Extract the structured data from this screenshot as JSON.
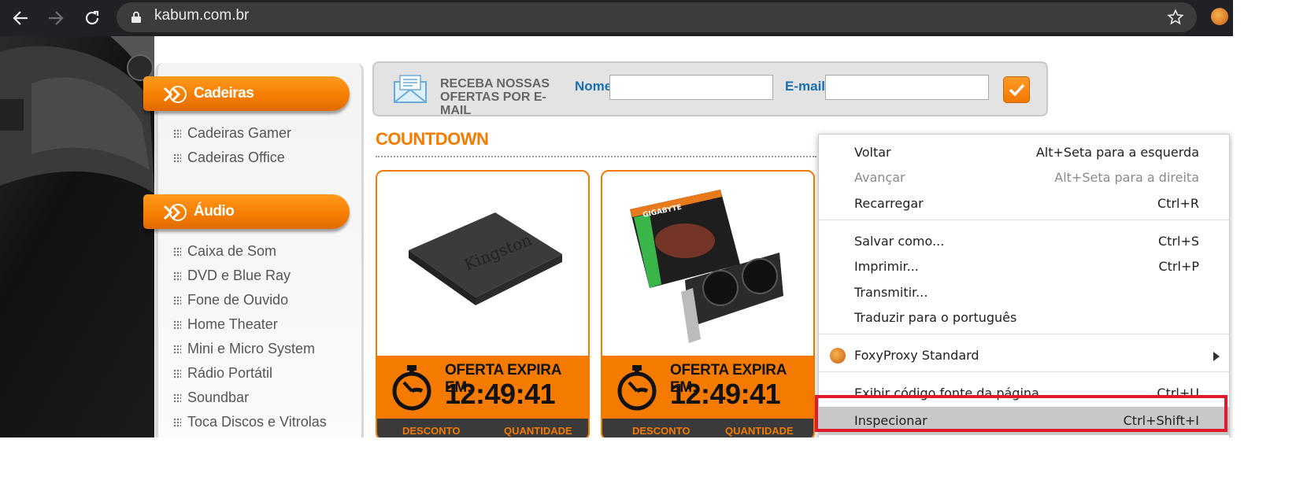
{
  "browser": {
    "url": "kabum.com.br",
    "colors": {
      "toolbar": "#202124",
      "omnibox": "#3c3c3f"
    }
  },
  "sidebar": {
    "sections": [
      {
        "title": "Cadeiras",
        "items": [
          "Cadeiras Gamer",
          "Cadeiras Office"
        ]
      },
      {
        "title": "Áudio",
        "items": [
          "Caixa de Som",
          "DVD e Blue Ray",
          "Fone de Ouvido",
          "Home Theater",
          "Mini e Micro System",
          "Rádio Portátil",
          "Soundbar",
          "Toca Discos e Vitrolas"
        ]
      }
    ]
  },
  "newsletter": {
    "line1": "RECEBA NOSSAS",
    "line2": "OFERTAS POR E-MAIL",
    "name_label": "Nome",
    "email_label": "E-mail",
    "name_value": "",
    "email_value": ""
  },
  "countdown": {
    "title": "COUNTDOWN",
    "cards": [
      {
        "offer_label": "OFERTA EXPIRA EM:",
        "timer": "12:49:41",
        "desconto": "DESCONTO",
        "quantidade": "QUANTIDADE",
        "product_image": "kingston-ssd"
      },
      {
        "offer_label": "OFERTA EXPIRA EM:",
        "timer": "12:49:41",
        "desconto": "DESCONTO",
        "quantidade": "QUANTIDADE",
        "product_image": "gigabyte-geforce-gtx"
      }
    ]
  },
  "context_menu": {
    "items": [
      {
        "label": "Voltar",
        "shortcut": "Alt+Seta para a esquerda"
      },
      {
        "label": "Avançar",
        "shortcut": "Alt+Seta para a direita",
        "disabled": true
      },
      {
        "label": "Recarregar",
        "shortcut": "Ctrl+R"
      },
      {
        "label": "Salvar como...",
        "shortcut": "Ctrl+S"
      },
      {
        "label": "Imprimir...",
        "shortcut": "Ctrl+P"
      },
      {
        "label": "Transmitir...",
        "shortcut": ""
      },
      {
        "label": "Traduzir para o português",
        "shortcut": ""
      },
      {
        "label": "FoxyProxy Standard",
        "shortcut": ""
      },
      {
        "label": "Exibir código fonte da página",
        "shortcut": "Ctrl+U"
      },
      {
        "label": "Inspecionar",
        "shortcut": "Ctrl+Shift+I",
        "highlighted": true
      }
    ],
    "highlight_color": "#e01b2b"
  },
  "brand_colors": {
    "orange": "#f47b00",
    "blue": "#1a6fb0"
  }
}
